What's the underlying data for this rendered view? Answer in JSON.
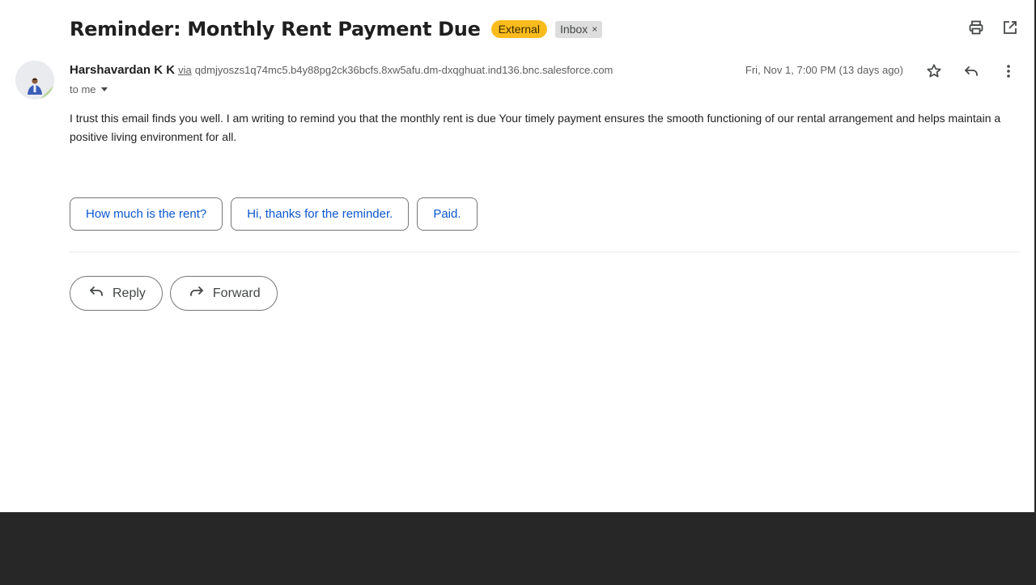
{
  "email": {
    "subject": "Reminder: Monthly Rent Payment Due",
    "labels": {
      "external": "External",
      "inbox": "Inbox",
      "inbox_remove": "×"
    },
    "sender": {
      "name": "Harshavardan K K",
      "via_label": "via",
      "via_address": "qdmjyoszs1q74mc5.b4y88pg2ck36bcfs.8xw5afu.dm-dxqghuat.ind136.bnc.salesforce.com"
    },
    "recipient": "to me",
    "date": "Fri, Nov 1, 7:00 PM (13 days ago)",
    "body": "I trust this email finds you well. I am writing to remind you that the monthly rent  is due Your timely payment ensures the smooth functioning of our rental arrangement and helps maintain a positive living environment for all.",
    "smart_replies": [
      "How much is the rent?",
      "Hi, thanks for the reminder.",
      "Paid."
    ],
    "actions": {
      "reply": "Reply",
      "forward": "Forward"
    }
  },
  "icons": {
    "print": "print-icon",
    "open_new_window": "open-in-new-window-icon",
    "star": "star-icon",
    "reply": "reply-icon",
    "more": "more-vert-icon",
    "forward": "forward-icon"
  },
  "colors": {
    "external_badge": "#f9bc1c",
    "inbox_badge": "#dddddd",
    "link_blue": "#0b57d0",
    "dark_band": "#272727"
  }
}
